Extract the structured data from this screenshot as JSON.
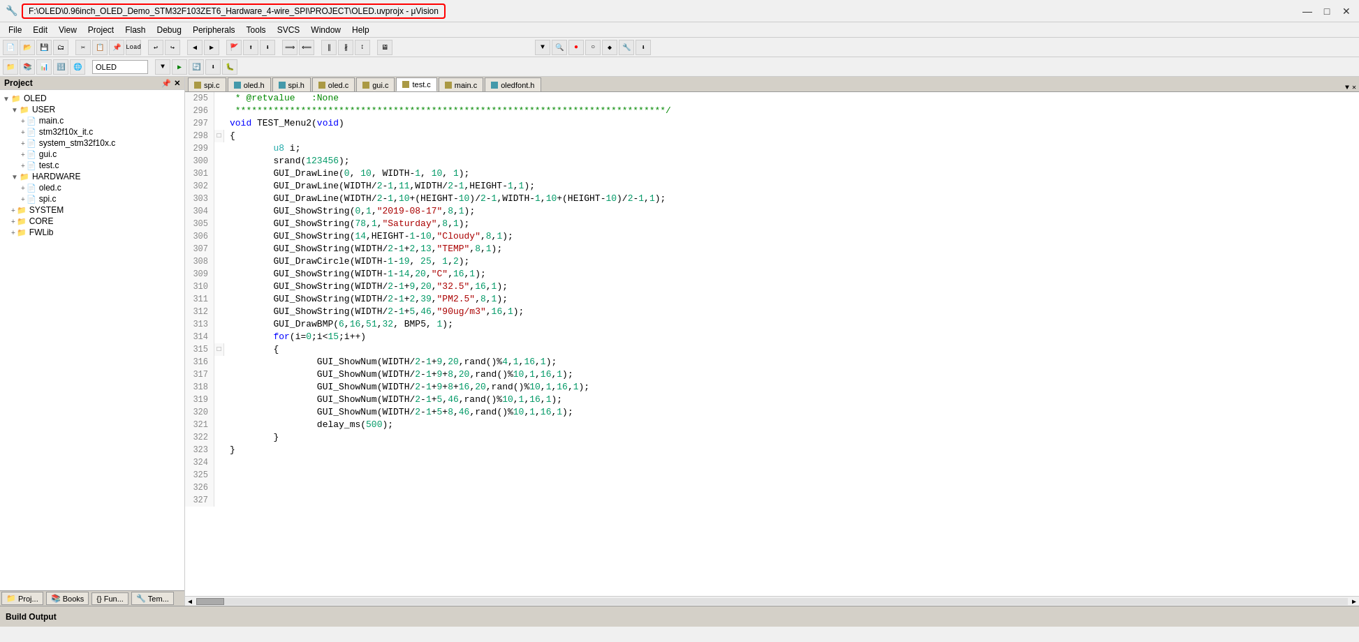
{
  "titlebar": {
    "title": "F:\\OLED\\0.96inch_OLED_Demo_STM32F103ZET6_Hardware_4-wire_SPI\\PROJECT\\OLED.uvprojx - μVision",
    "minimize": "—",
    "maximize": "□",
    "close": "✕"
  },
  "menubar": {
    "items": [
      "File",
      "Edit",
      "View",
      "Project",
      "Flash",
      "Debug",
      "Peripherals",
      "Tools",
      "SVCS",
      "Window",
      "Help"
    ]
  },
  "toolbar": {
    "target": "OLED"
  },
  "project": {
    "header": "Project",
    "tree": [
      {
        "level": 0,
        "expand": "▼",
        "icon": "📁",
        "label": "OLED"
      },
      {
        "level": 1,
        "expand": "▼",
        "icon": "📁",
        "label": "USER"
      },
      {
        "level": 2,
        "expand": "+",
        "icon": "📄",
        "label": "main.c"
      },
      {
        "level": 2,
        "expand": "+",
        "icon": "📄",
        "label": "stm32f10x_it.c"
      },
      {
        "level": 2,
        "expand": "+",
        "icon": "📄",
        "label": "system_stm32f10x.c"
      },
      {
        "level": 2,
        "expand": "+",
        "icon": "📄",
        "label": "gui.c"
      },
      {
        "level": 2,
        "expand": "+",
        "icon": "📄",
        "label": "test.c"
      },
      {
        "level": 1,
        "expand": "▼",
        "icon": "📁",
        "label": "HARDWARE"
      },
      {
        "level": 2,
        "expand": "+",
        "icon": "📄",
        "label": "oled.c"
      },
      {
        "level": 2,
        "expand": "+",
        "icon": "📄",
        "label": "spi.c"
      },
      {
        "level": 1,
        "expand": "+",
        "icon": "📁",
        "label": "SYSTEM"
      },
      {
        "level": 1,
        "expand": "+",
        "icon": "📁",
        "label": "CORE"
      },
      {
        "level": 1,
        "expand": "+",
        "icon": "📁",
        "label": "FWLib"
      }
    ]
  },
  "tabs": [
    {
      "label": "spi.c",
      "type": "c",
      "active": false
    },
    {
      "label": "oled.h",
      "type": "h",
      "active": false
    },
    {
      "label": "spi.h",
      "type": "h",
      "active": false
    },
    {
      "label": "oled.c",
      "type": "c",
      "active": false
    },
    {
      "label": "gui.c",
      "type": "c",
      "active": false
    },
    {
      "label": "test.c",
      "type": "c",
      "active": true
    },
    {
      "label": "main.c",
      "type": "c",
      "active": false
    },
    {
      "label": "oledfont.h",
      "type": "h",
      "active": false
    }
  ],
  "code": {
    "lines": [
      {
        "num": 295,
        "fold": "",
        "text": " * @retvalue   :None"
      },
      {
        "num": 296,
        "fold": "",
        "text": " *******************************************************************************/"
      },
      {
        "num": 297,
        "fold": "",
        "text": "void TEST_Menu2(void)"
      },
      {
        "num": 298,
        "fold": "□",
        "text": "{"
      },
      {
        "num": 299,
        "fold": "",
        "text": "\tu8 i;"
      },
      {
        "num": 300,
        "fold": "",
        "text": "\tsrand(123456);"
      },
      {
        "num": 301,
        "fold": "",
        "text": "\tGUI_DrawLine(0, 10, WIDTH-1, 10, 1);"
      },
      {
        "num": 302,
        "fold": "",
        "text": "\tGUI_DrawLine(WIDTH/2-1,11,WIDTH/2-1,HEIGHT-1,1);"
      },
      {
        "num": 303,
        "fold": "",
        "text": "\tGUI_DrawLine(WIDTH/2-1,10+(HEIGHT-10)/2-1,WIDTH-1,10+(HEIGHT-10)/2-1,1);"
      },
      {
        "num": 304,
        "fold": "",
        "text": "\tGUI_ShowString(0,1,\"2019-08-17\",8,1);"
      },
      {
        "num": 305,
        "fold": "",
        "text": "\tGUI_ShowString(78,1,\"Saturday\",8,1);"
      },
      {
        "num": 306,
        "fold": "",
        "text": "\tGUI_ShowString(14,HEIGHT-1-10,\"Cloudy\",8,1);"
      },
      {
        "num": 307,
        "fold": "",
        "text": "\tGUI_ShowString(WIDTH/2-1+2,13,\"TEMP\",8,1);"
      },
      {
        "num": 308,
        "fold": "",
        "text": "\tGUI_DrawCircle(WIDTH-1-19, 25, 1,2);"
      },
      {
        "num": 309,
        "fold": "",
        "text": "\tGUI_ShowString(WIDTH-1-14,20,\"C\",16,1);"
      },
      {
        "num": 310,
        "fold": "",
        "text": "\tGUI_ShowString(WIDTH/2-1+9,20,\"32.5\",16,1);"
      },
      {
        "num": 311,
        "fold": "",
        "text": "\tGUI_ShowString(WIDTH/2-1+2,39,\"PM2.5\",8,1);"
      },
      {
        "num": 312,
        "fold": "",
        "text": "\tGUI_ShowString(WIDTH/2-1+5,46,\"90ug/m3\",16,1);"
      },
      {
        "num": 313,
        "fold": "",
        "text": "\tGUI_DrawBMP(6,16,51,32, BMP5, 1);"
      },
      {
        "num": 314,
        "fold": "",
        "text": "\tfor(i=0;i<15;i++)"
      },
      {
        "num": 315,
        "fold": "□",
        "text": "\t{"
      },
      {
        "num": 316,
        "fold": "",
        "text": "\t\tGUI_ShowNum(WIDTH/2-1+9,20,rand()%4,1,16,1);"
      },
      {
        "num": 317,
        "fold": "",
        "text": "\t\tGUI_ShowNum(WIDTH/2-1+9+8,20,rand()%10,1,16,1);"
      },
      {
        "num": 318,
        "fold": "",
        "text": "\t\tGUI_ShowNum(WIDTH/2-1+9+8+16,20,rand()%10,1,16,1);"
      },
      {
        "num": 319,
        "fold": "",
        "text": "\t\tGUI_ShowNum(WIDTH/2-1+5,46,rand()%10,1,16,1);"
      },
      {
        "num": 320,
        "fold": "",
        "text": "\t\tGUI_ShowNum(WIDTH/2-1+5+8,46,rand()%10,1,16,1);"
      },
      {
        "num": 321,
        "fold": "",
        "text": "\t\tdelay_ms(500);"
      },
      {
        "num": 322,
        "fold": "",
        "text": "\t}"
      },
      {
        "num": 323,
        "fold": "",
        "text": "}"
      },
      {
        "num": 324,
        "fold": "",
        "text": ""
      },
      {
        "num": 325,
        "fold": "",
        "text": ""
      },
      {
        "num": 326,
        "fold": "",
        "text": ""
      },
      {
        "num": 327,
        "fold": "",
        "text": ""
      }
    ]
  },
  "project_tabs": [
    {
      "label": "Proj...",
      "icon": "📁"
    },
    {
      "label": "Books",
      "icon": "📚"
    },
    {
      "label": "{} Fun...",
      "icon": "{}"
    },
    {
      "label": "Tem...",
      "icon": "🔧"
    }
  ],
  "build_output": {
    "label": "Build Output"
  }
}
